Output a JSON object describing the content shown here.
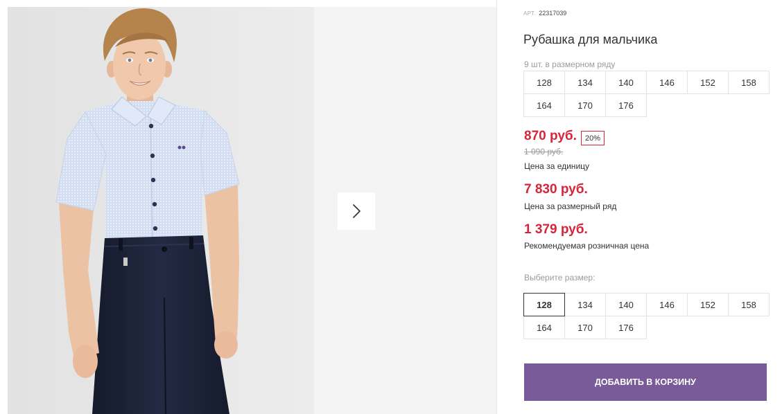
{
  "product": {
    "article_label": "АРТ.",
    "article": "22317039",
    "title": "Рубашка для мальчика",
    "pack_note": "9 шт. в размерном ряду",
    "pack_sizes": [
      "128",
      "134",
      "140",
      "146",
      "152",
      "158",
      "164",
      "170",
      "176"
    ],
    "price": "870 руб.",
    "discount": "20%",
    "old_price": "1 090 руб.",
    "price_caption": "Цена за единицу",
    "pack_price": "7 830 руб.",
    "pack_price_caption": "Цена за размерный ряд",
    "retail_price": "1 379 руб.",
    "retail_price_caption": "Рекомендуемая розничная цена",
    "choose_size_label": "Выберите размер:",
    "sizes": [
      "128",
      "134",
      "140",
      "146",
      "152",
      "158",
      "164",
      "170",
      "176"
    ],
    "selected_size": "128",
    "add_to_cart_label": "ДОБАВИТЬ В КОРЗИНУ"
  },
  "gallery": {
    "next_icon": "chevron-right-icon"
  },
  "colors": {
    "price": "#d6243a",
    "button": "#7a5b99",
    "selected_border": "#333333"
  }
}
